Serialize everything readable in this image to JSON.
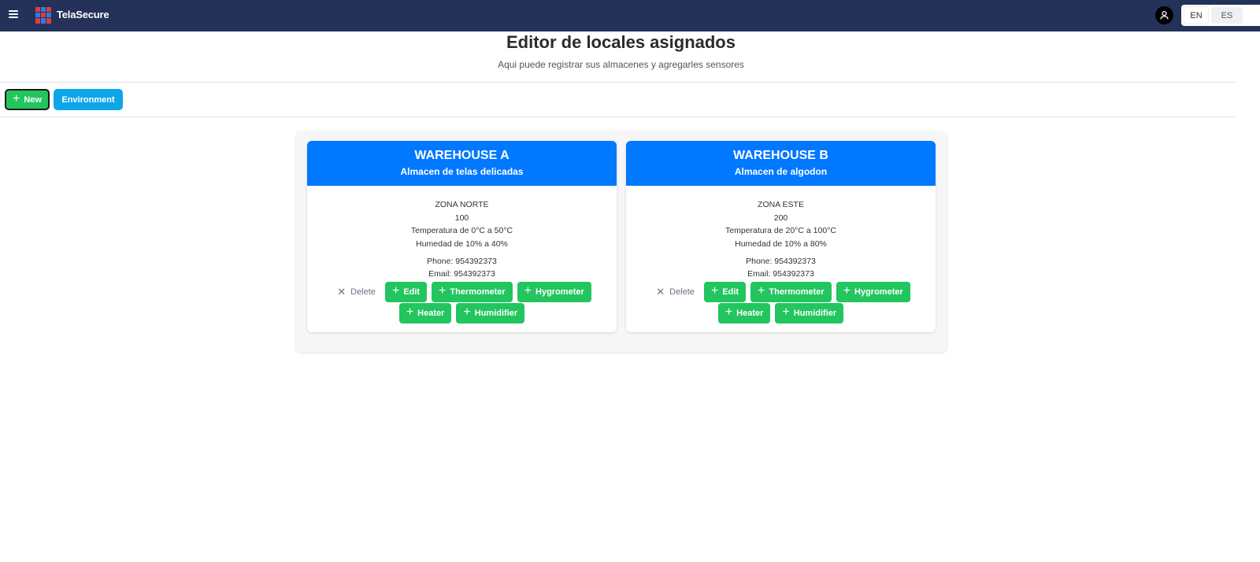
{
  "app": {
    "brand": "TelaSecure"
  },
  "header": {
    "lang_en": "EN",
    "lang_es": "ES"
  },
  "page": {
    "title": "Editor de locales asignados",
    "subtitle": "Aqui puede registrar sus almacenes y agregarles sensores"
  },
  "toolbar": {
    "new_label": "New",
    "environment_label": "Environment"
  },
  "colors": {
    "topbar": "#243159",
    "card_header": "#0078ff",
    "action_green": "#22c55e",
    "environment_blue": "#0ea5e9"
  },
  "warehouses": [
    {
      "name": "WAREHOUSE A",
      "description": "Almacen de telas delicadas",
      "zone": "ZONA NORTE",
      "capacity": "100",
      "temperature": "Temperatura de 0°C a 50°C",
      "humidity": "Humedad de 10% a 40%",
      "phone": "Phone: 954392373",
      "email": "Email: 954392373",
      "actions": {
        "delete": "Delete",
        "edit": "Edit",
        "thermometer": "Thermometer",
        "hygrometer": "Hygrometer",
        "heater": "Heater",
        "humidifier": "Humidifier"
      }
    },
    {
      "name": "WAREHOUSE B",
      "description": "Almacen de algodon",
      "zone": "ZONA ESTE",
      "capacity": "200",
      "temperature": "Temperatura de 20°C a 100°C",
      "humidity": "Humedad de 10% a 80%",
      "phone": "Phone: 954392373",
      "email": "Email: 954392373",
      "actions": {
        "delete": "Delete",
        "edit": "Edit",
        "thermometer": "Thermometer",
        "hygrometer": "Hygrometer",
        "heater": "Heater",
        "humidifier": "Humidifier"
      }
    }
  ]
}
